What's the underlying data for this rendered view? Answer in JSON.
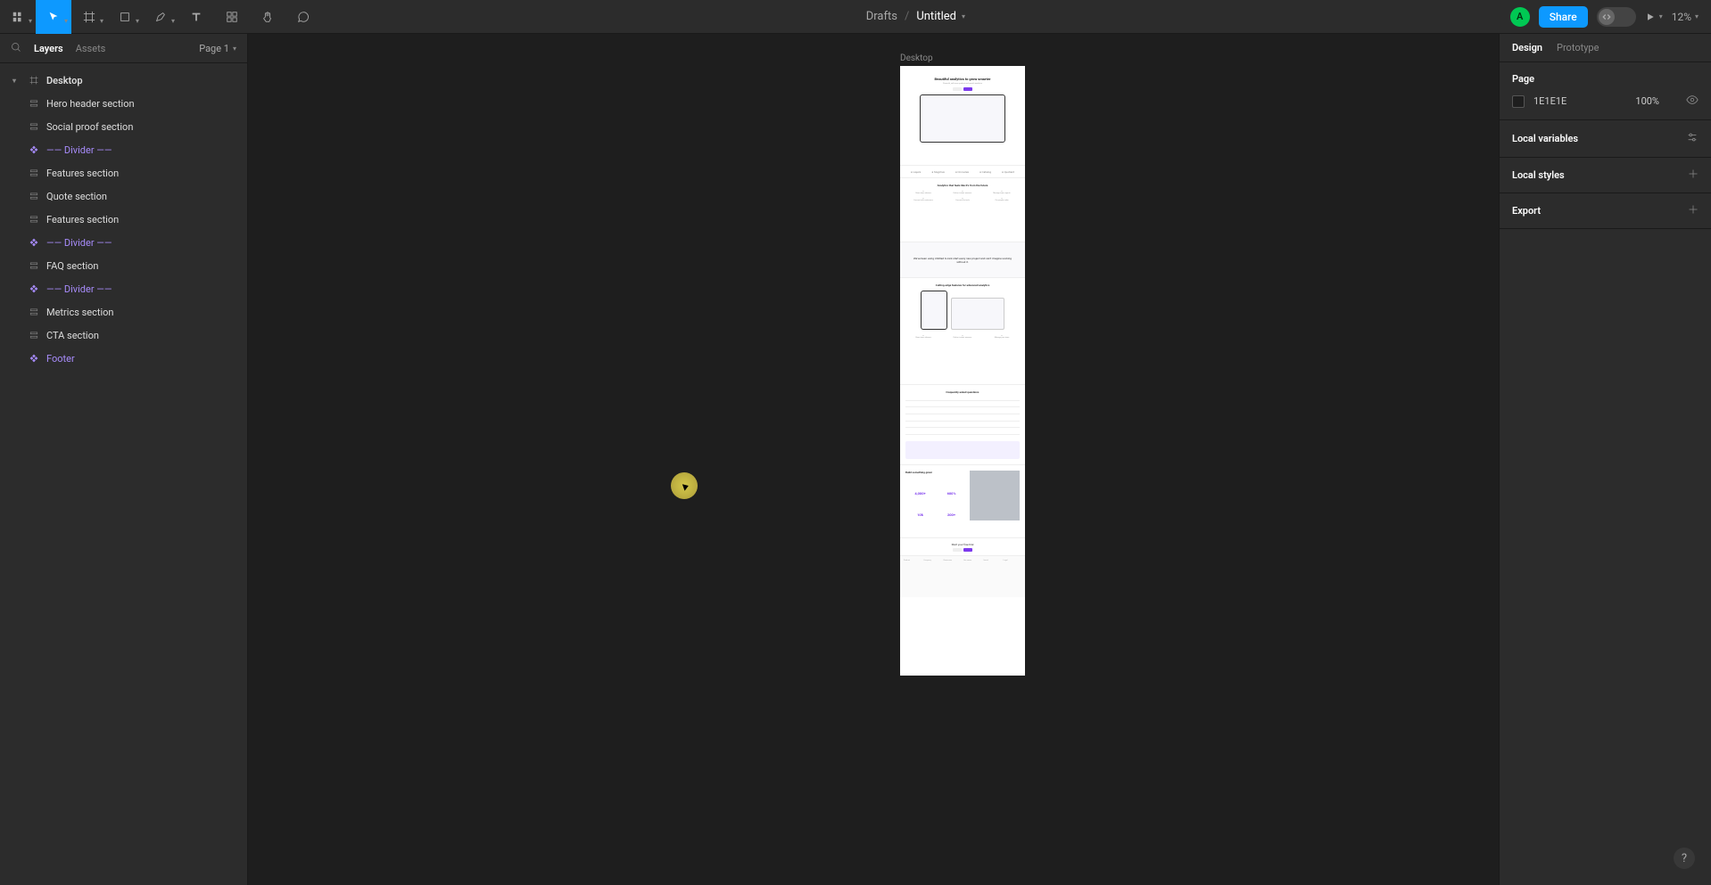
{
  "toolbar": {
    "breadcrumb_drafts": "Drafts",
    "breadcrumb_title": "Untitled",
    "share_label": "Share",
    "zoom_level": "12%",
    "avatar_initial": "A"
  },
  "left_panel": {
    "tab_layers": "Layers",
    "tab_assets": "Assets",
    "page_selector": "Page 1",
    "layers": [
      {
        "label": "Desktop",
        "type": "frame",
        "top": true
      },
      {
        "label": "Hero header section",
        "type": "auto"
      },
      {
        "label": "Social proof section",
        "type": "auto"
      },
      {
        "label": "—— Divider ——",
        "type": "component"
      },
      {
        "label": "Features section",
        "type": "auto"
      },
      {
        "label": "Quote section",
        "type": "auto"
      },
      {
        "label": "Features section",
        "type": "auto"
      },
      {
        "label": "—— Divider ——",
        "type": "component"
      },
      {
        "label": "FAQ section",
        "type": "auto"
      },
      {
        "label": "—— Divider ——",
        "type": "component"
      },
      {
        "label": "Metrics section",
        "type": "auto"
      },
      {
        "label": "CTA section",
        "type": "auto"
      },
      {
        "label": "Footer",
        "type": "component"
      }
    ]
  },
  "canvas": {
    "frame_label": "Desktop",
    "artboard": {
      "hero_title": "Beautiful analytics to grow smarter",
      "features_title": "Analytics that feels like it's from the future",
      "quote_text": "We've been using Untitled to kick start every new project and can't imagine working without it.",
      "adv_title": "Cutting-edge features for advanced analytics",
      "faq_title": "Frequently asked questions",
      "metrics_heading": "Build something great",
      "metrics": [
        "4,000+",
        "600%",
        "10k",
        "200+"
      ],
      "cta_title": "Start your free trial"
    }
  },
  "right_panel": {
    "tab_design": "Design",
    "tab_prototype": "Prototype",
    "page_section_title": "Page",
    "page_bg_hex": "1E1E1E",
    "page_bg_opacity": "100%",
    "local_variables_title": "Local variables",
    "local_styles_title": "Local styles",
    "export_title": "Export"
  }
}
